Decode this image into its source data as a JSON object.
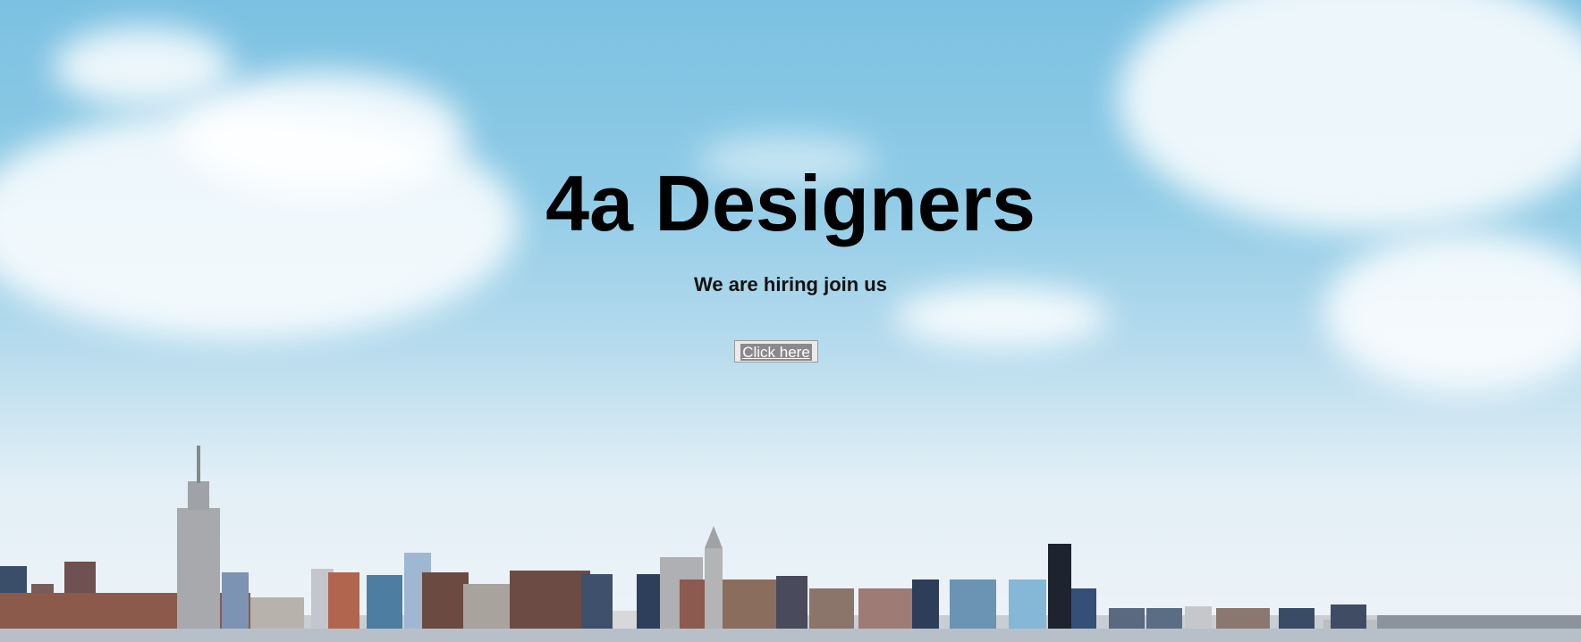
{
  "hero": {
    "title": "4a Designers",
    "subtitle": "We are hiring join us",
    "cta_label": "Click here",
    "background": "city-skyline-image"
  },
  "colors": {
    "sky_top": "#7cc1e2",
    "sky_bottom": "#eef4f8",
    "title": "#000000",
    "button_bg": "#eaeaea",
    "link_bg": "#8a8a8a"
  }
}
